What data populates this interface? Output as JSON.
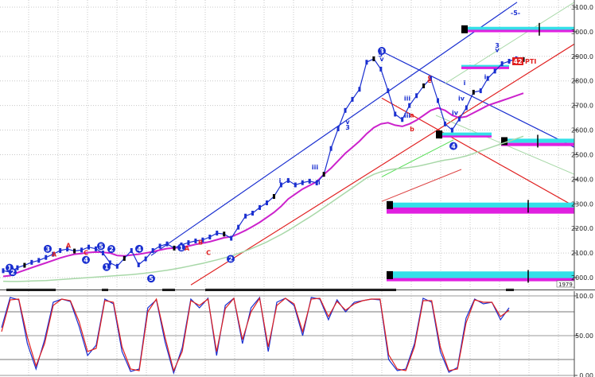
{
  "chart_data": [
    {
      "type": "line",
      "panel": "price",
      "title": "",
      "xlabel": "",
      "ylabel": "",
      "ylim": [
        1965,
        3130
      ],
      "yticks": [
        2000,
        2100,
        2200,
        2300,
        2400,
        2500,
        2600,
        2700,
        2800,
        2900,
        3000,
        3100
      ],
      "ytick_labels": [
        "2000.0",
        "2100.0",
        "2200.0",
        "2300.0",
        "2400.0",
        "2500.0",
        "2600.0",
        "2700.0",
        "2800.0",
        "2900.0",
        "3000.0",
        "3100.0"
      ],
      "grid": true,
      "colors": {
        "price": "#1a2fd0",
        "ma_long": "#cc22cc",
        "ma_slow": "#a8d8a8",
        "channel": "#1a2fd0",
        "trend": "#e02020",
        "zone_cyan": "#33e0e8",
        "zone_magenta": "#e020e0"
      },
      "last_price_label": "2887",
      "series": [
        {
          "values": [
            2028,
            2022,
            2040,
            2050,
            2062,
            2070,
            2082,
            2095,
            2110,
            2116,
            2108,
            2112,
            2124,
            2117,
            2100,
            2060,
            2046,
            2078,
            2110,
            2052,
            2076,
            2110,
            2128,
            2137,
            2120,
            2133,
            2142,
            2149,
            2153,
            2165,
            2181,
            2177,
            2160,
            2205,
            2250,
            2262,
            2285,
            2304,
            2330,
            2377,
            2395,
            2377,
            2386,
            2392,
            2385,
            2420,
            2525,
            2605,
            2680,
            2725,
            2766,
            2876,
            2890,
            2848,
            2760,
            2665,
            2643,
            2700,
            2740,
            2780,
            2810,
            2720,
            2625,
            2600,
            2645,
            2691,
            2754,
            2760,
            2810,
            2840,
            2870,
            2880,
            2890,
            2887
          ]
        },
        {
          "values": [
            2005,
            2008,
            2020,
            2030,
            2040,
            2050,
            2060,
            2070,
            2080,
            2088,
            2095,
            2098,
            2102,
            2104,
            2103,
            2100,
            2090,
            2088,
            2092,
            2095,
            2100,
            2105,
            2112,
            2118,
            2120,
            2124,
            2128,
            2135,
            2140,
            2146,
            2154,
            2162,
            2166,
            2178,
            2192,
            2208,
            2225,
            2245,
            2265,
            2290,
            2320,
            2340,
            2360,
            2375,
            2390,
            2420,
            2445,
            2475,
            2505,
            2530,
            2555,
            2585,
            2610,
            2625,
            2630,
            2620,
            2615,
            2625,
            2640,
            2660,
            2680,
            2690,
            2680,
            2660,
            2650,
            2655,
            2670,
            2685,
            2700,
            2710,
            2720,
            2730,
            2740,
            2750
          ]
        },
        {
          "values": [
            1985,
            1984,
            1984,
            1985,
            1986,
            1987,
            1988,
            1990,
            1992,
            1994,
            1996,
            1998,
            2000,
            2002,
            2004,
            2006,
            2008,
            2010,
            2012,
            2015,
            2018,
            2022,
            2026,
            2030,
            2035,
            2040,
            2046,
            2052,
            2058,
            2065,
            2072,
            2080,
            2088,
            2098,
            2108,
            2120,
            2132,
            2145,
            2160,
            2175,
            2192,
            2210,
            2228,
            2246,
            2265,
            2285,
            2305,
            2325,
            2345,
            2365,
            2385,
            2405,
            2420,
            2430,
            2438,
            2442,
            2445,
            2448,
            2452,
            2458,
            2465,
            2472,
            2478,
            2482,
            2488,
            2495,
            2505,
            2515,
            2525,
            2535,
            2545,
            2555,
            2565,
            2575
          ]
        }
      ],
      "annotations": [
        {
          "text": "1",
          "color": "blue"
        },
        {
          "text": "2",
          "color": "blue"
        },
        {
          "text": "3",
          "color": "blue"
        },
        {
          "text": "4",
          "color": "blue"
        },
        {
          "text": "5",
          "color": "blue"
        },
        {
          "text": "A",
          "color": "red"
        },
        {
          "text": "B",
          "color": "red"
        },
        {
          "text": "C",
          "color": "red"
        },
        {
          "text": "i",
          "color": "blue"
        },
        {
          "text": "ii",
          "color": "blue"
        },
        {
          "text": "iii",
          "color": "blue"
        },
        {
          "text": "iv",
          "color": "blue"
        },
        {
          "text": "v",
          "color": "blue"
        },
        {
          "text": "a",
          "color": "red"
        },
        {
          "text": "b",
          "color": "red"
        },
        {
          "text": "c",
          "color": "red"
        },
        {
          "text": "e",
          "color": "red"
        },
        {
          "text": "-5-",
          "color": "blue"
        },
        {
          "text": "42",
          "color": "red"
        },
        {
          "text": "PTI",
          "color": "red"
        },
        {
          "text": "1979",
          "color": "black"
        }
      ]
    },
    {
      "type": "line",
      "panel": "oscillator",
      "title": "",
      "xlabel": "",
      "ylabel": "",
      "ylim": [
        0,
        100
      ],
      "yticks": [
        0,
        50,
        100
      ],
      "ytick_labels": [
        "0.00",
        "50.00",
        "100.0"
      ],
      "grid": true,
      "series": [
        {
          "color": "#1a2fd0",
          "values": [
            60,
            98,
            95,
            40,
            8,
            45,
            92,
            96,
            93,
            62,
            25,
            38,
            96,
            90,
            30,
            5,
            8,
            85,
            95,
            42,
            3,
            35,
            96,
            85,
            97,
            25,
            88,
            97,
            40,
            85,
            98,
            30,
            92,
            97,
            88,
            50,
            98,
            96,
            70,
            95,
            80,
            92,
            94,
            96,
            95,
            20,
            6,
            8,
            40,
            97,
            92,
            30,
            4,
            10,
            72,
            96,
            90,
            92,
            70,
            85
          ]
        },
        {
          "color": "#e02020",
          "values": [
            55,
            95,
            96,
            48,
            12,
            40,
            88,
            96,
            94,
            68,
            30,
            34,
            94,
            92,
            36,
            8,
            6,
            80,
            96,
            48,
            6,
            30,
            94,
            88,
            96,
            30,
            84,
            97,
            45,
            80,
            97,
            36,
            88,
            97,
            90,
            55,
            96,
            97,
            74,
            93,
            82,
            90,
            94,
            96,
            96,
            26,
            8,
            6,
            36,
            94,
            94,
            36,
            6,
            8,
            66,
            95,
            92,
            92,
            74,
            82
          ]
        }
      ]
    }
  ]
}
